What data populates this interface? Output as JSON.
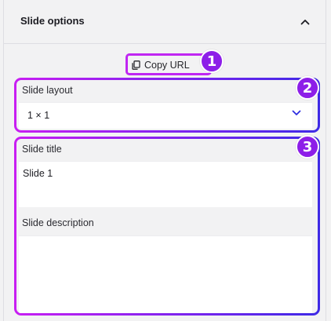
{
  "panel": {
    "title": "Slide options",
    "collapse_icon": "chevron-up-icon"
  },
  "copy_url": {
    "label": "Copy URL",
    "icon": "copy-icon"
  },
  "callouts": [
    "1",
    "2",
    "3"
  ],
  "slide_layout": {
    "label": "Slide layout",
    "value": "1 × 1",
    "icon": "chevron-down-icon"
  },
  "slide_title": {
    "label": "Slide title",
    "value": "Slide 1"
  },
  "slide_description": {
    "label": "Slide description",
    "value": ""
  },
  "colors": {
    "callout": "#8d1ee8",
    "highlight_start": "#c81ef2",
    "highlight_end": "#3e2ae6",
    "chevron": "#2b2be0"
  }
}
